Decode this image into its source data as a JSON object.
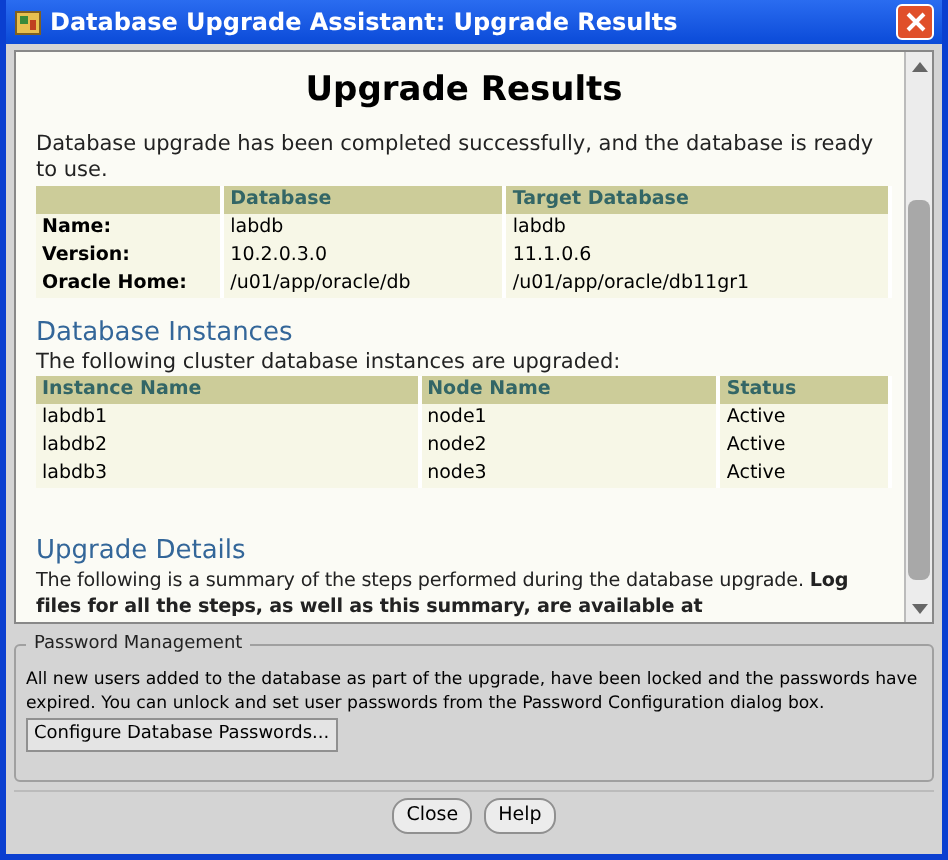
{
  "window": {
    "title": "Database Upgrade Assistant: Upgrade Results"
  },
  "results": {
    "title": "Upgrade Results",
    "intro": "Database upgrade has been completed successfully, and the database is ready to use.",
    "summary_table": {
      "columns": [
        "",
        "Database",
        "Target Database"
      ],
      "rows": [
        [
          "Name:",
          "labdb",
          "labdb"
        ],
        [
          "Version:",
          "10.2.0.3.0",
          "11.1.0.6"
        ],
        [
          "Oracle Home:",
          "/u01/app/oracle/db",
          "/u01/app/oracle/db11gr1"
        ]
      ]
    }
  },
  "instances": {
    "heading": "Database Instances",
    "description": "The following cluster database instances are upgraded:",
    "table": {
      "columns": [
        "Instance Name",
        "Node Name",
        "Status"
      ],
      "rows": [
        [
          "labdb1",
          "node1",
          "Active"
        ],
        [
          "labdb2",
          "node2",
          "Active"
        ],
        [
          "labdb3",
          "node3",
          "Active"
        ]
      ]
    }
  },
  "details": {
    "heading": "Upgrade Details",
    "text": "The following is a summary of the steps performed during the database upgrade. **Log files for all the steps, as well as this summary, are available at**"
  },
  "password_management": {
    "legend": "Password Management",
    "message": "All new users added to the database as part of the upgrade, have been locked and the passwords have expired. You can unlock and set user passwords from the Password Configuration dialog box.",
    "button": "Configure Database Passwords..."
  },
  "buttons": [
    "Close",
    "Help"
  ]
}
